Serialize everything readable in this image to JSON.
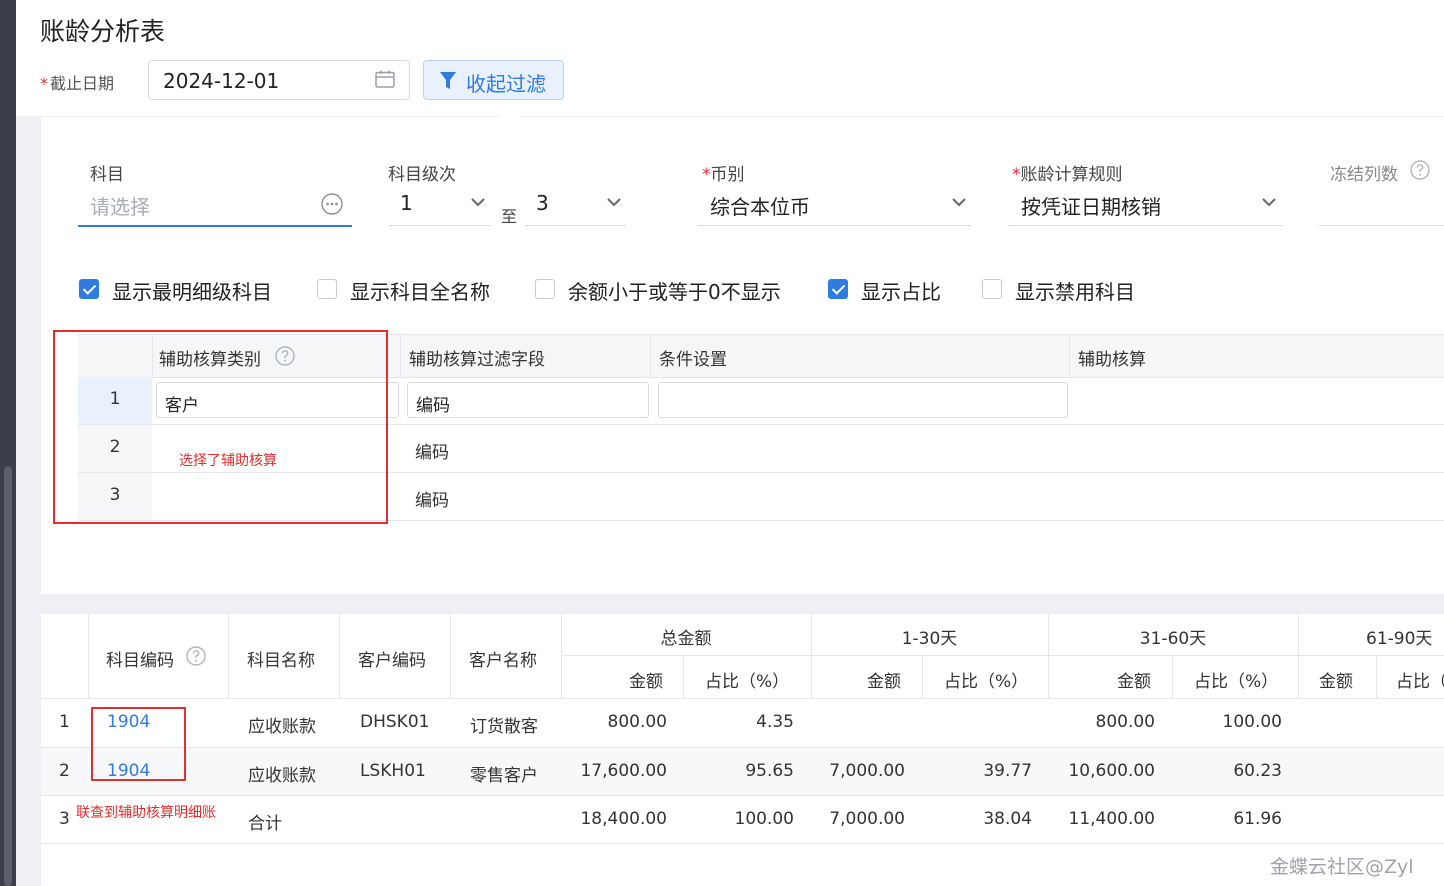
{
  "title": "账龄分析表",
  "cutoff": {
    "label": "截止日期",
    "value": "2024-12-01"
  },
  "filter_toggle_label": "收起过滤",
  "filters": {
    "subject": {
      "label": "科目",
      "placeholder": "请选择"
    },
    "subject_level": {
      "label": "科目级次",
      "from": "1",
      "to_label": "至",
      "to": "3"
    },
    "currency": {
      "label": "币别",
      "value": "综合本位币"
    },
    "aging_rule": {
      "label": "账龄计算规则",
      "value": "按凭证日期核销"
    },
    "freeze_cols": {
      "label": "冻结列数"
    }
  },
  "checkboxes": [
    {
      "label": "显示最明细级科目",
      "checked": true
    },
    {
      "label": "显示科目全名称",
      "checked": false
    },
    {
      "label": "余额小于或等于0不显示",
      "checked": false
    },
    {
      "label": "显示占比",
      "checked": true
    },
    {
      "label": "显示禁用科目",
      "checked": false
    }
  ],
  "aux_grid": {
    "headers": [
      "辅助核算类别",
      "辅助核算过滤字段",
      "条件设置",
      "辅助核算"
    ],
    "rows": [
      {
        "num": "1",
        "category": "客户",
        "field": "编码",
        "condition": ""
      },
      {
        "num": "2",
        "category": "",
        "field": "编码"
      },
      {
        "num": "3",
        "category": "",
        "field": "编码"
      }
    ],
    "note": "选择了辅助核算"
  },
  "report": {
    "headers": {
      "code": "科目编码",
      "name": "科目名称",
      "cust_code": "客户编码",
      "cust_name": "客户名称",
      "groups": [
        "总金额",
        "1-30天",
        "31-60天",
        "61-90天"
      ],
      "amount": "金额",
      "ratio": "占比（%）",
      "ratio_cut": "占比（"
    },
    "rows": [
      {
        "num": "1",
        "code": "1904",
        "name": "应收账款",
        "cust_code": "DHSK01",
        "cust_name": "订货散客",
        "total": "800.00",
        "total_pct": "4.35",
        "d1_30": "",
        "d1_30_pct": "",
        "d31_60": "800.00",
        "d31_60_pct": "100.00"
      },
      {
        "num": "2",
        "code": "1904",
        "name": "应收账款",
        "cust_code": "LSKH01",
        "cust_name": "零售客户",
        "total": "17,600.00",
        "total_pct": "95.65",
        "d1_30": "7,000.00",
        "d1_30_pct": "39.77",
        "d31_60": "10,600.00",
        "d31_60_pct": "60.23"
      },
      {
        "num": "3",
        "code": "",
        "name": "合计",
        "cust_code": "",
        "cust_name": "",
        "total": "18,400.00",
        "total_pct": "100.00",
        "d1_30": "7,000.00",
        "d1_30_pct": "38.04",
        "d31_60": "11,400.00",
        "d31_60_pct": "61.96"
      }
    ],
    "note": "联查到辅助核算明细账"
  },
  "watermark": "金蝶云社区@Zyl",
  "colors": {
    "accent": "#2f7be0",
    "annotation": "#e0302f"
  }
}
